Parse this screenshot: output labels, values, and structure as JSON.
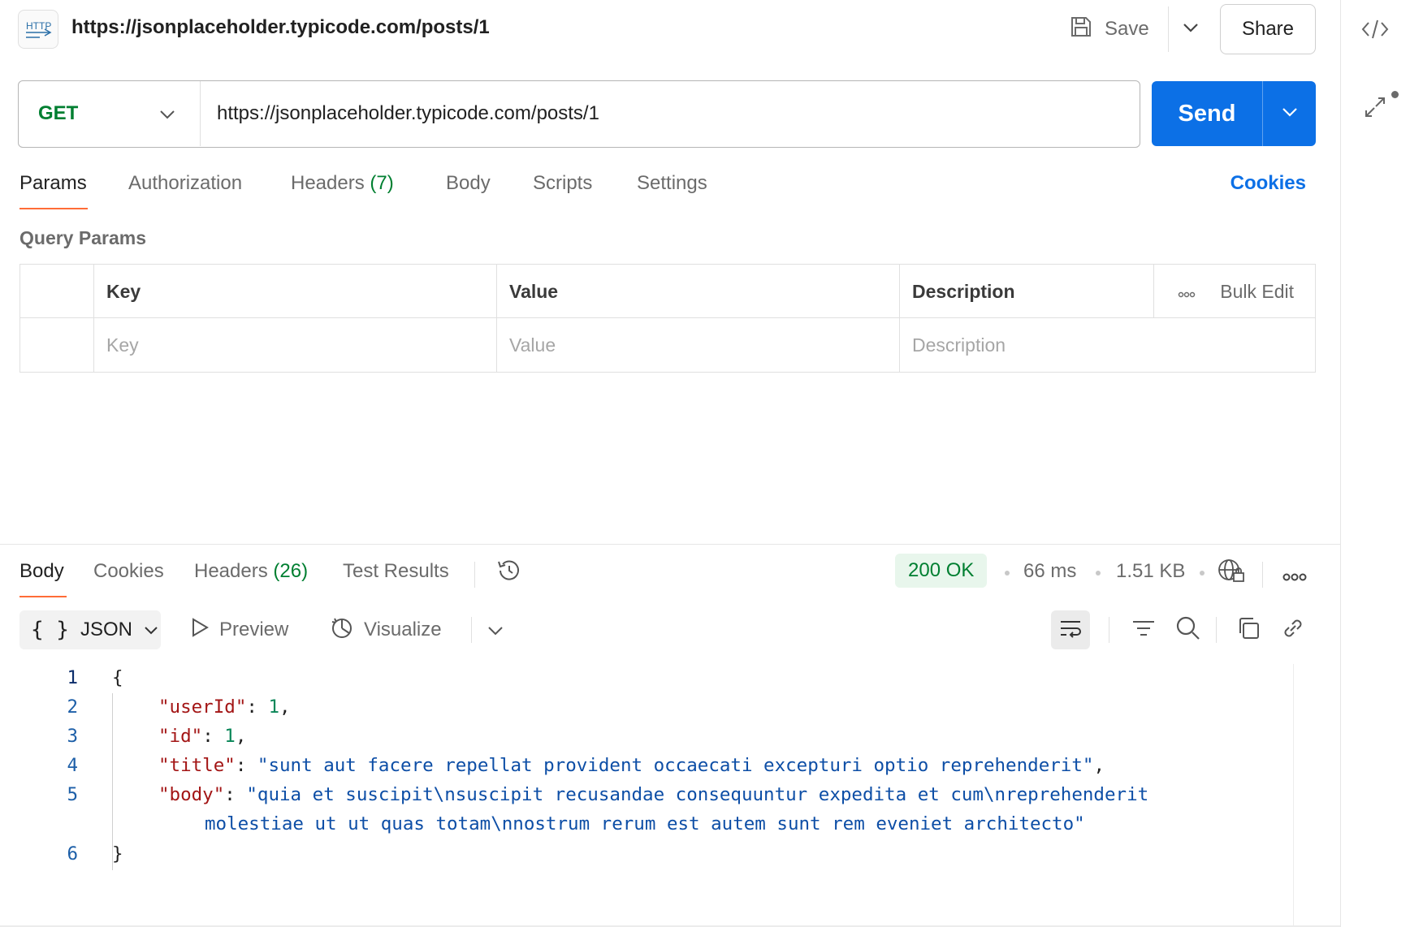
{
  "header": {
    "badge": "HTTP",
    "title": "https://jsonplaceholder.typicode.com/posts/1",
    "save_label": "Save",
    "share_label": "Share"
  },
  "request": {
    "method": "GET",
    "url": "https://jsonplaceholder.typicode.com/posts/1",
    "send_label": "Send"
  },
  "request_tabs": {
    "params": "Params",
    "authorization": "Authorization",
    "headers": "Headers",
    "headers_count": "(7)",
    "body": "Body",
    "scripts": "Scripts",
    "settings": "Settings",
    "cookies": "Cookies"
  },
  "query_params": {
    "title": "Query Params",
    "columns": [
      "Key",
      "Value",
      "Description"
    ],
    "bulk_edit": "Bulk Edit",
    "placeholders": [
      "Key",
      "Value",
      "Description"
    ]
  },
  "response_tabs": {
    "body": "Body",
    "cookies": "Cookies",
    "headers": "Headers",
    "headers_count": "(26)",
    "test_results": "Test Results"
  },
  "response_meta": {
    "status": "200 OK",
    "time": "66 ms",
    "size": "1.51 KB"
  },
  "response_toolbar": {
    "format": "JSON",
    "preview": "Preview",
    "visualize": "Visualize"
  },
  "response_body": {
    "line_numbers": [
      "1",
      "2",
      "3",
      "4",
      "5",
      "6"
    ],
    "open_brace": "{",
    "close_brace": "}",
    "userId_key": "\"userId\"",
    "userId_value": "1",
    "id_key": "\"id\"",
    "id_value": "1",
    "title_key": "\"title\"",
    "title_value": "\"sunt aut facere repellat provident occaecati excepturi optio reprehenderit\"",
    "body_key": "\"body\"",
    "body_value_line1": "\"quia et suscipit\\nsuscipit recusandae consequuntur expedita et cum\\nreprehenderit",
    "body_value_line2": "molestiae ut ut quas totam\\nnostrum rerum est autem sunt rem eveniet architecto\""
  },
  "colors": {
    "accent_orange": "#ff6c37",
    "send_blue": "#0c70e6",
    "method_green": "#007f31",
    "json_key": "#a31515",
    "json_string": "#0d4ea6",
    "json_number": "#098658"
  }
}
